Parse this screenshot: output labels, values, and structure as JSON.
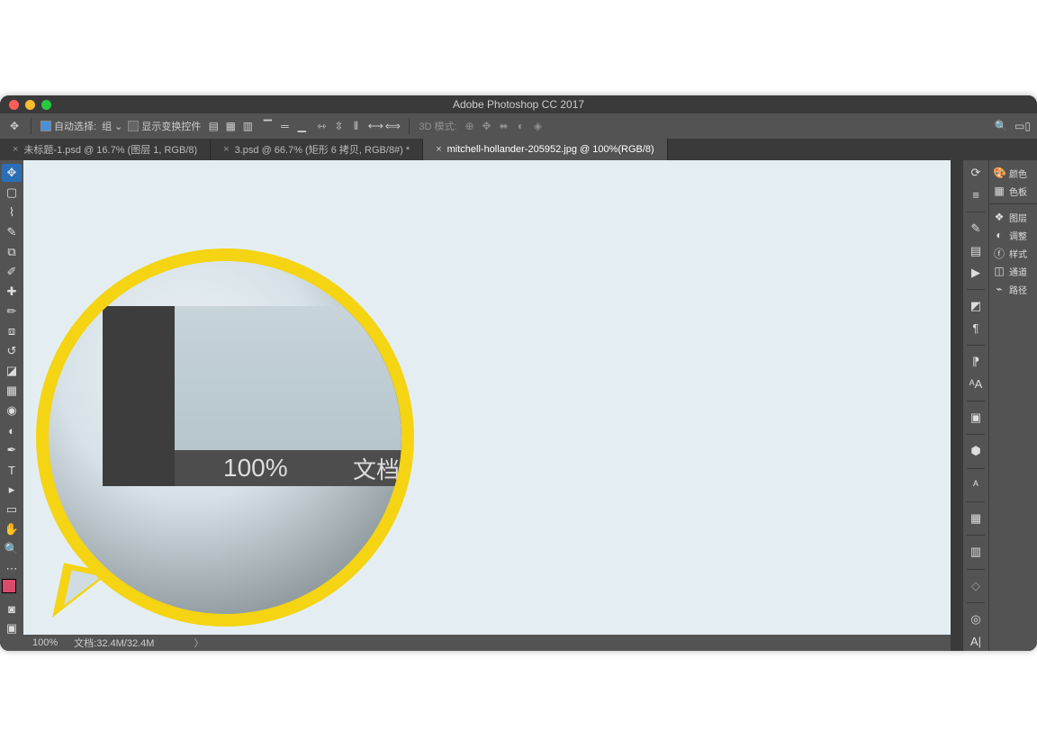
{
  "title": "Adobe Photoshop CC 2017",
  "optionsbar": {
    "autoSelectLabel": "自动选择:",
    "autoSelectValue": "组",
    "showTransformLabel": "显示变换控件",
    "mode3dLabel": "3D 模式:"
  },
  "tabs": [
    {
      "close": "×",
      "label": "未标题-1.psd @ 16.7% (图层 1, RGB/8)"
    },
    {
      "close": "×",
      "label": "3.psd @ 66.7% (矩形 6 拷贝, RGB/8#) *"
    },
    {
      "close": "×",
      "label": "mitchell-hollander-205952.jpg @ 100%(RGB/8)"
    }
  ],
  "status": {
    "zoom": "100%",
    "doc": "文档:32.4M/32.4M",
    "chev": "〉"
  },
  "panels": {
    "color": "颜色",
    "swatches": "色板",
    "layers": "图层",
    "adjust": "调整",
    "styles": "样式",
    "channels": "通道",
    "paths": "路径"
  },
  "magnifier": {
    "zoom": "100%",
    "doc": "文档"
  }
}
